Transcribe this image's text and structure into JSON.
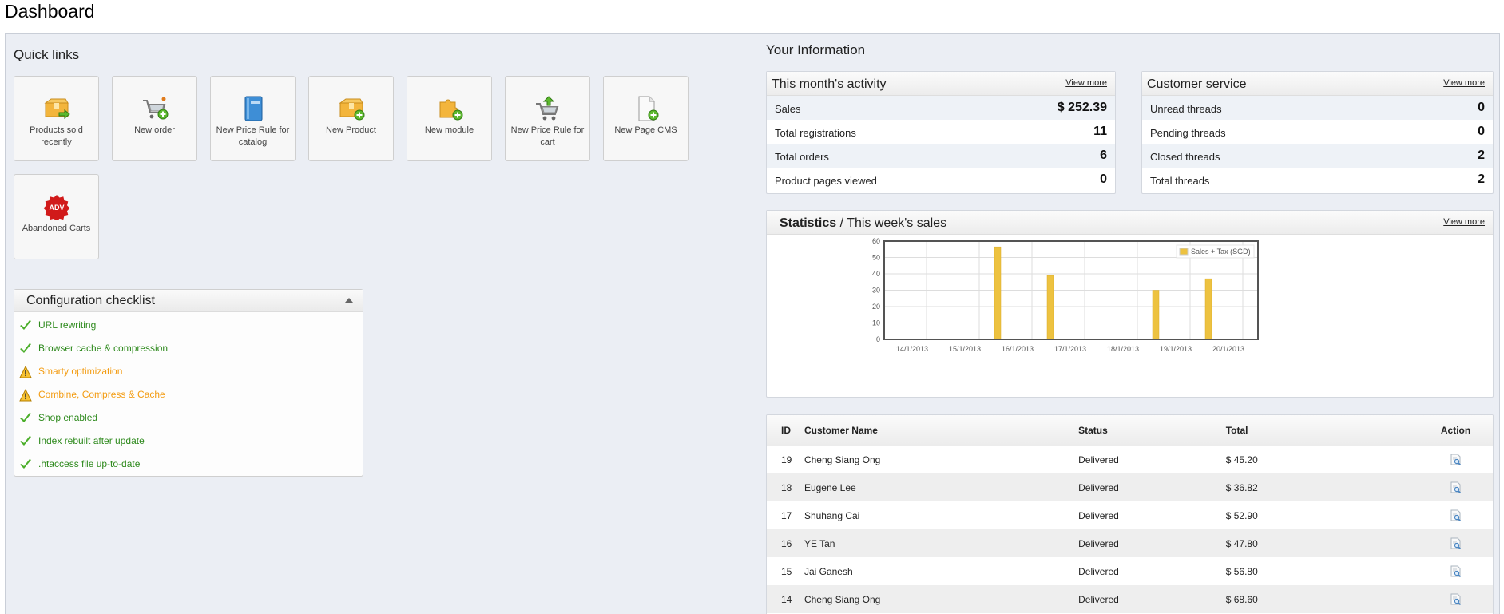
{
  "page": {
    "title": "Dashboard"
  },
  "quick_links": {
    "title": "Quick links",
    "items": [
      {
        "label": "Products sold recently",
        "icon": "product-box-arrow-icon"
      },
      {
        "label": "New order",
        "icon": "cart-add-icon"
      },
      {
        "label": "New Price Rule for catalog",
        "icon": "catalog-book-icon"
      },
      {
        "label": "New Product",
        "icon": "product-box-add-icon"
      },
      {
        "label": "New module",
        "icon": "puzzle-add-icon"
      },
      {
        "label": "New Price Rule for cart",
        "icon": "cart-rule-icon"
      },
      {
        "label": "New Page CMS",
        "icon": "page-add-icon"
      },
      {
        "label": "Abandoned Carts",
        "icon": "adv-badge-icon"
      }
    ],
    "adv_badge_text": "ADV"
  },
  "checklist": {
    "title": "Configuration checklist",
    "items": [
      {
        "label": "URL rewriting",
        "status": "ok"
      },
      {
        "label": "Browser cache & compression",
        "status": "ok"
      },
      {
        "label": "Smarty optimization",
        "status": "warn"
      },
      {
        "label": "Combine, Compress & Cache",
        "status": "warn"
      },
      {
        "label": "Shop enabled",
        "status": "ok"
      },
      {
        "label": "Index rebuilt after update",
        "status": "ok"
      },
      {
        "label": ".htaccess file up-to-date",
        "status": "ok"
      }
    ]
  },
  "your_information": {
    "title": "Your Information",
    "activity": {
      "title": "This month's activity",
      "view_more": "View more",
      "rows": [
        {
          "label": "Sales",
          "value": "$ 252.39"
        },
        {
          "label": "Total registrations",
          "value": "11"
        },
        {
          "label": "Total orders",
          "value": "6"
        },
        {
          "label": "Product pages viewed",
          "value": "0"
        }
      ]
    },
    "customer_service": {
      "title": "Customer service",
      "view_more": "View more",
      "rows": [
        {
          "label": "Unread threads",
          "value": "0"
        },
        {
          "label": "Pending threads",
          "value": "0"
        },
        {
          "label": "Closed threads",
          "value": "2"
        },
        {
          "label": "Total threads",
          "value": "2"
        }
      ]
    },
    "statistics": {
      "title_bold": "Statistics",
      "title_rest": " / This week's sales",
      "view_more": "View more"
    }
  },
  "chart_data": {
    "type": "bar",
    "categories": [
      "14/1/2013",
      "15/1/2013",
      "16/1/2013",
      "17/1/2013",
      "18/1/2013",
      "19/1/2013",
      "20/1/2013"
    ],
    "series": [
      {
        "name": "Sales + Tax (SGD)",
        "values": [
          0,
          0,
          56.5,
          39,
          0,
          30,
          37
        ]
      }
    ],
    "ylim": [
      0,
      60
    ],
    "yticks": [
      0,
      10,
      20,
      30,
      40,
      50,
      60
    ],
    "grid": true,
    "legend": "top-right",
    "color": "#edc240"
  },
  "orders": {
    "columns": [
      "ID",
      "Customer Name",
      "Status",
      "Total",
      "Action"
    ],
    "rows": [
      {
        "id": "19",
        "name": "Cheng Siang Ong",
        "status": "Delivered",
        "total": "$ 45.20"
      },
      {
        "id": "18",
        "name": "Eugene Lee",
        "status": "Delivered",
        "total": "$ 36.82"
      },
      {
        "id": "17",
        "name": "Shuhang Cai",
        "status": "Delivered",
        "total": "$ 52.90"
      },
      {
        "id": "16",
        "name": "YE Tan",
        "status": "Delivered",
        "total": "$ 47.80"
      },
      {
        "id": "15",
        "name": "Jai Ganesh",
        "status": "Delivered",
        "total": "$ 56.80"
      },
      {
        "id": "14",
        "name": "Cheng Siang Ong",
        "status": "Delivered",
        "total": "$ 68.60"
      }
    ],
    "action_icon": "view-details-icon"
  },
  "colors": {
    "ok": "#2e8a1d",
    "warn": "#f39c12",
    "bar": "#edc240",
    "adv_red": "#d11a1a"
  }
}
